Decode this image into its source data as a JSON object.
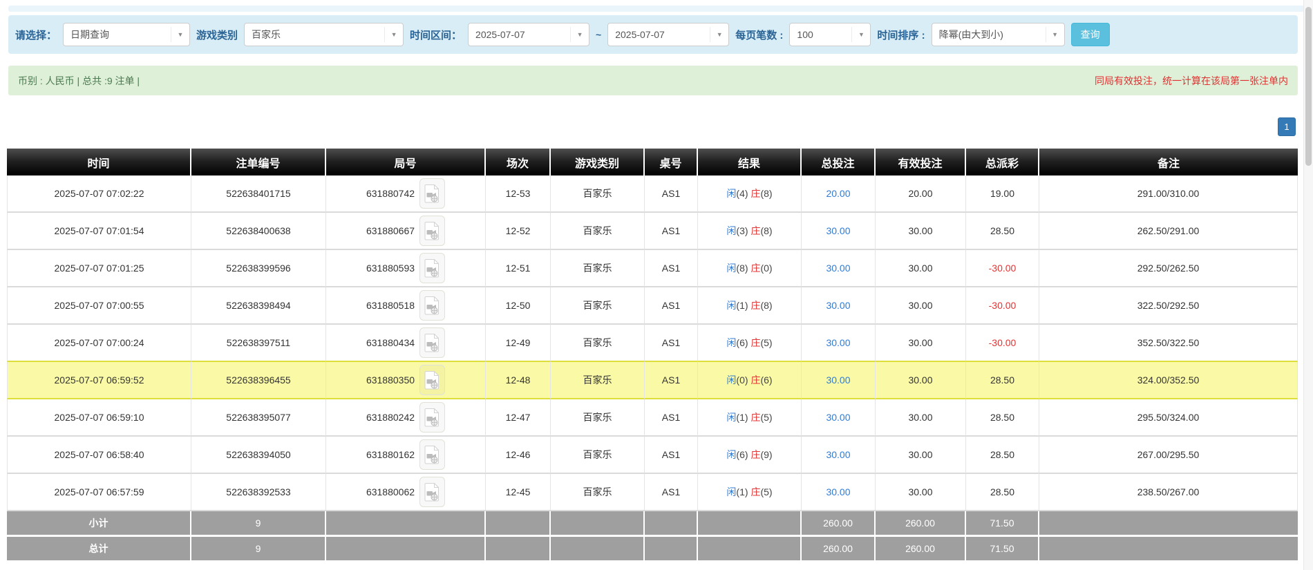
{
  "filters": {
    "select_label": "请选择：",
    "select_value": "日期查询",
    "game_type_label": "游戏类别",
    "game_type_value": "百家乐",
    "time_range_label": "时间区间：",
    "date_from": "2025-07-07",
    "tilde": "~",
    "date_to": "2025-07-07",
    "page_size_label": "每页笔数 :",
    "page_size_value": "100",
    "sort_label": "时间排序 :",
    "sort_value": "降幂(由大到小)",
    "query_button": "查询"
  },
  "summary": {
    "left_text": "币别 : 人民币 | 总共 :9 注单 |",
    "right_text": "同局有效投注，统一计算在该局第一张注单内"
  },
  "pagination": {
    "current_page": "1"
  },
  "table": {
    "headers": [
      "时间",
      "注单编号",
      "局号",
      "场次",
      "游戏类别",
      "桌号",
      "结果",
      "总投注",
      "有效投注",
      "总派彩",
      "备注"
    ],
    "rows": [
      {
        "time": "2025-07-07 07:02:22",
        "bet_id": "522638401715",
        "round_id": "631880742",
        "session": "12-53",
        "game": "百家乐",
        "table_no": "AS1",
        "player_label": "闲",
        "player_points": "(4)",
        "banker_label": "庄",
        "banker_points": "(8)",
        "total_bet": "20.00",
        "valid_bet": "20.00",
        "payout": "19.00",
        "note": "291.00/310.00",
        "highlight": false
      },
      {
        "time": "2025-07-07 07:01:54",
        "bet_id": "522638400638",
        "round_id": "631880667",
        "session": "12-52",
        "game": "百家乐",
        "table_no": "AS1",
        "player_label": "闲",
        "player_points": "(3)",
        "banker_label": "庄",
        "banker_points": "(8)",
        "total_bet": "30.00",
        "valid_bet": "30.00",
        "payout": "28.50",
        "note": "262.50/291.00",
        "highlight": false
      },
      {
        "time": "2025-07-07 07:01:25",
        "bet_id": "522638399596",
        "round_id": "631880593",
        "session": "12-51",
        "game": "百家乐",
        "table_no": "AS1",
        "player_label": "闲",
        "player_points": "(8)",
        "banker_label": "庄",
        "banker_points": "(0)",
        "total_bet": "30.00",
        "valid_bet": "30.00",
        "payout": "-30.00",
        "note": "292.50/262.50",
        "highlight": false
      },
      {
        "time": "2025-07-07 07:00:55",
        "bet_id": "522638398494",
        "round_id": "631880518",
        "session": "12-50",
        "game": "百家乐",
        "table_no": "AS1",
        "player_label": "闲",
        "player_points": "(1)",
        "banker_label": "庄",
        "banker_points": "(8)",
        "total_bet": "30.00",
        "valid_bet": "30.00",
        "payout": "-30.00",
        "note": "322.50/292.50",
        "highlight": false
      },
      {
        "time": "2025-07-07 07:00:24",
        "bet_id": "522638397511",
        "round_id": "631880434",
        "session": "12-49",
        "game": "百家乐",
        "table_no": "AS1",
        "player_label": "闲",
        "player_points": "(6)",
        "banker_label": "庄",
        "banker_points": "(5)",
        "total_bet": "30.00",
        "valid_bet": "30.00",
        "payout": "-30.00",
        "note": "352.50/322.50",
        "highlight": false
      },
      {
        "time": "2025-07-07 06:59:52",
        "bet_id": "522638396455",
        "round_id": "631880350",
        "session": "12-48",
        "game": "百家乐",
        "table_no": "AS1",
        "player_label": "闲",
        "player_points": "(0)",
        "banker_label": "庄",
        "banker_points": "(6)",
        "total_bet": "30.00",
        "valid_bet": "30.00",
        "payout": "28.50",
        "note": "324.00/352.50",
        "highlight": true
      },
      {
        "time": "2025-07-07 06:59:10",
        "bet_id": "522638395077",
        "round_id": "631880242",
        "session": "12-47",
        "game": "百家乐",
        "table_no": "AS1",
        "player_label": "闲",
        "player_points": "(1)",
        "banker_label": "庄",
        "banker_points": "(5)",
        "total_bet": "30.00",
        "valid_bet": "30.00",
        "payout": "28.50",
        "note": "295.50/324.00",
        "highlight": false
      },
      {
        "time": "2025-07-07 06:58:40",
        "bet_id": "522638394050",
        "round_id": "631880162",
        "session": "12-46",
        "game": "百家乐",
        "table_no": "AS1",
        "player_label": "闲",
        "player_points": "(6)",
        "banker_label": "庄",
        "banker_points": "(9)",
        "total_bet": "30.00",
        "valid_bet": "30.00",
        "payout": "28.50",
        "note": "267.00/295.50",
        "highlight": false
      },
      {
        "time": "2025-07-07 06:57:59",
        "bet_id": "522638392533",
        "round_id": "631880062",
        "session": "12-45",
        "game": "百家乐",
        "table_no": "AS1",
        "player_label": "闲",
        "player_points": "(1)",
        "banker_label": "庄",
        "banker_points": "(5)",
        "total_bet": "30.00",
        "valid_bet": "30.00",
        "payout": "28.50",
        "note": "238.50/267.00",
        "highlight": false
      }
    ],
    "subtotal": {
      "label": "小计",
      "count": "9",
      "total_bet": "260.00",
      "valid_bet": "260.00",
      "payout": "71.50"
    },
    "total": {
      "label": "总计",
      "count": "9",
      "total_bet": "260.00",
      "valid_bet": "260.00",
      "payout": "71.50"
    }
  },
  "icons": {
    "dropdown_caret": "chevron-down-icon",
    "round_video": "video-icon"
  },
  "colors": {
    "panel_blue": "#d9edf7",
    "label_blue": "#2a6496",
    "button_cyan": "#5bc0de",
    "bar_green": "#dff0d8",
    "note_red": "#e03131",
    "header_black": "#111111",
    "link_blue": "#2e7bd6",
    "banker_red": "#e23333",
    "negative_red": "#e23333",
    "highlight_yellow": "#fafaa6",
    "footer_gray": "#9f9f9f",
    "pagination_blue": "#337ab7"
  }
}
